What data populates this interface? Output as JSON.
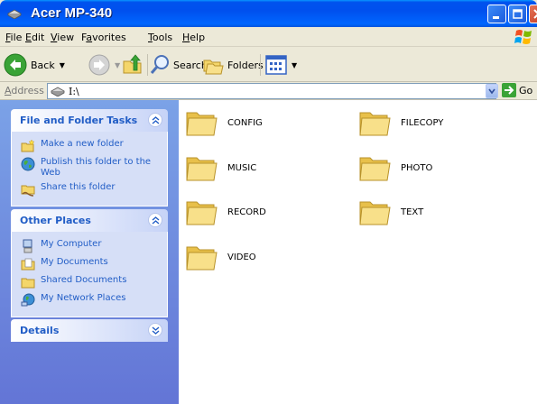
{
  "window": {
    "title": "Acer MP-340"
  },
  "menu": [
    {
      "label": "File",
      "key": "F",
      "rest": "ile"
    },
    {
      "label": "Edit",
      "key": "E",
      "rest": "dit"
    },
    {
      "label": "View",
      "key": "V",
      "rest": "iew"
    },
    {
      "label": "Favorites",
      "key": "a",
      "pre": "F",
      "rest": "vorites"
    },
    {
      "label": "Tools",
      "key": "T",
      "rest": "ools"
    },
    {
      "label": "Help",
      "key": "H",
      "rest": "elp"
    }
  ],
  "toolbar": {
    "back": "Back",
    "search": "Search",
    "folders": "Folders"
  },
  "address": {
    "label": "Address",
    "value": "I:\\",
    "go": "Go"
  },
  "tasks_panel": {
    "title": "File and Folder Tasks",
    "items": [
      "Make a new folder",
      "Publish this folder to the Web",
      "Share this folder"
    ]
  },
  "places_panel": {
    "title": "Other Places",
    "items": [
      "My Computer",
      "My Documents",
      "Shared Documents",
      "My Network Places"
    ]
  },
  "details_panel": {
    "title": "Details"
  },
  "folders": [
    "CONFIG",
    "FILECOPY",
    "MUSIC",
    "PHOTO",
    "RECORD",
    "TEXT",
    "VIDEO"
  ],
  "colors": {
    "titlebar": "#0054e3",
    "taskpane": "#6f8fe0",
    "link": "#215dc6",
    "folder": "#f4d66a"
  }
}
